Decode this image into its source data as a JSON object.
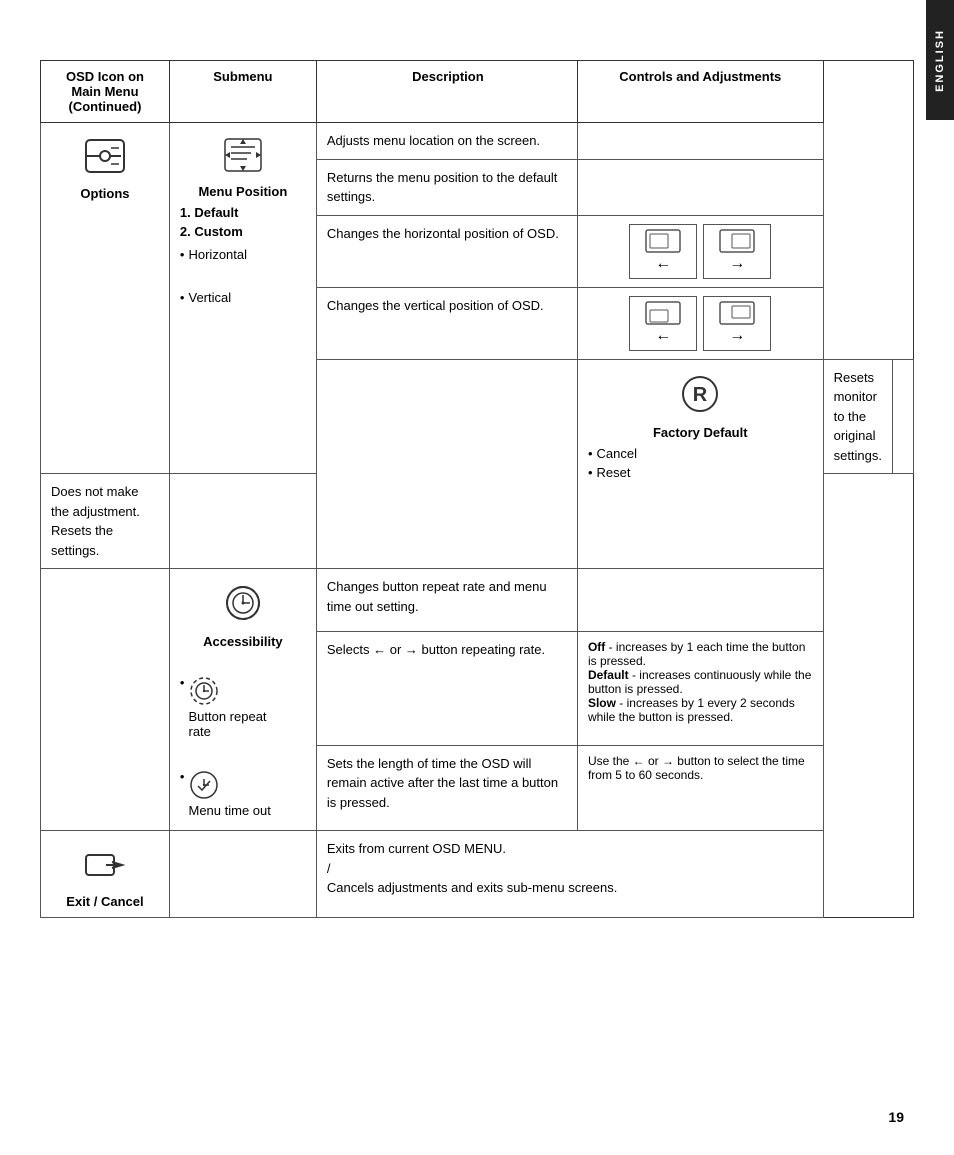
{
  "side_tab": {
    "text": "ENGLISH"
  },
  "header": {
    "col_osd": "OSD Icon on\nMain Menu\n(Continued)",
    "col_sub": "Submenu",
    "col_desc": "Description",
    "col_ctrl": "Controls and Adjustments"
  },
  "rows": [
    {
      "id": "options",
      "osd_label": "Options",
      "sub_label": "Menu Position",
      "sub_items": [
        {
          "bold": true,
          "text": "1. Default"
        },
        {
          "bold": true,
          "text": "2. Custom"
        },
        {
          "bullet": true,
          "text": "Horizontal"
        },
        {
          "bullet": true,
          "text": "Vertical"
        }
      ],
      "descriptions": [
        "Adjusts menu location on the screen.",
        "Returns the menu position to the default settings.",
        "",
        "Changes the horizontal position of OSD.",
        "Changes the vertical position of OSD."
      ],
      "has_arrows": true
    },
    {
      "id": "factory",
      "osd_label": null,
      "sub_label": "Factory Default",
      "sub_items": [
        {
          "bullet": true,
          "text": "Cancel"
        },
        {
          "bullet": true,
          "text": "Reset"
        }
      ],
      "descriptions": [
        "Resets monitor to the original settings.",
        "Does not make the adjustment.\nResets the settings."
      ]
    },
    {
      "id": "accessibility",
      "osd_label": null,
      "sub_label": "Accessibility",
      "sub_items": [
        {
          "bullet": true,
          "text": "Button repeat\nrate"
        },
        {
          "bullet": true,
          "text": "Menu time out"
        }
      ],
      "descriptions": [
        "Changes button repeat rate and menu time out setting.",
        "Selects ← or → button repeating rate.",
        "Sets the length of time the OSD will remain active after the last time a button is pressed."
      ],
      "ctrl_button_repeat": "Off - increases by 1 each time the button is pressed.\nDefault - increases continuously while the button is pressed.\nSlow - increases by 1 every 2 seconds while the button is pressed.",
      "ctrl_menu_timeout": "Use the ← or → button to select the time from 5 to 60 seconds."
    },
    {
      "id": "exit",
      "osd_label": "Exit / Cancel",
      "sub_label": null,
      "descriptions": [
        "Exits from current OSD MENU.\n/\nCancels adjustments and exits sub-menu screens."
      ]
    }
  ],
  "page_number": "19"
}
